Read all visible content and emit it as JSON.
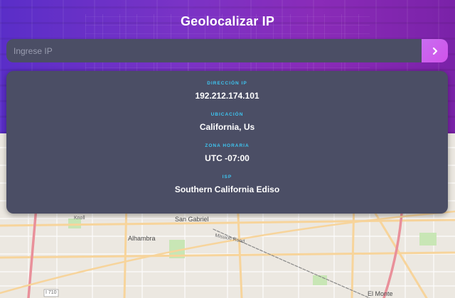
{
  "header": {
    "title": "Geolocalizar IP"
  },
  "search": {
    "placeholder": "Ingrese IP",
    "value": "",
    "button_icon": "chevron-right-icon"
  },
  "result": {
    "ip_label": "DIRECCIÓN IP",
    "ip_value": "192.212.174.101",
    "location_label": "UBICACIÓN",
    "location_value": "California, Us",
    "timezone_label": "ZONA HORARIA",
    "timezone_value": "UTC -07:00",
    "isp_label": "ISP",
    "isp_value": "Southern California Ediso"
  },
  "map": {
    "labels": {
      "san_gabriel": "San Gabriel",
      "alhambra": "Alhambra",
      "el_monte": "El Monte",
      "highway": "I 710",
      "knoll": "Knoll",
      "mission_road": "Mission Road"
    }
  },
  "colors": {
    "accent": "#3ec6f2",
    "card": "#4b4e65",
    "button": "#d152ea",
    "header_gradient_start": "#5a2ec8",
    "header_gradient_end": "#7a22a8"
  }
}
